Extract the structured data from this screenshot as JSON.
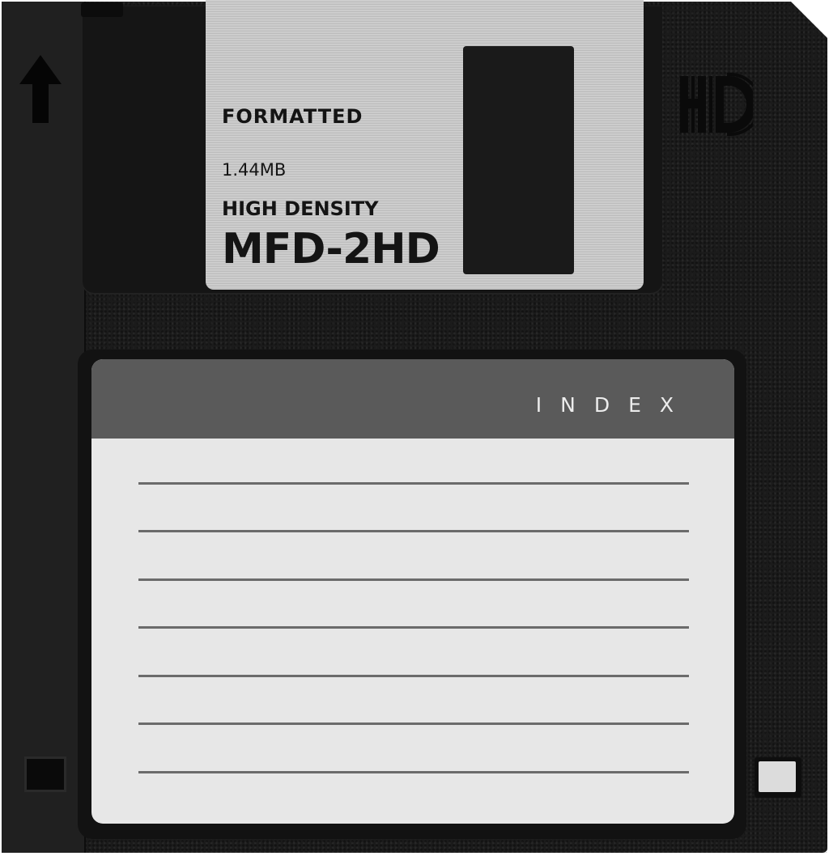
{
  "shutter_label": {
    "status": "FORMATTED",
    "capacity": "1.44MB",
    "density": "HIGH DENSITY",
    "model": "MFD-2HD"
  },
  "logo": {
    "text": "HD"
  },
  "index_label": {
    "title": "INDEX",
    "line_count": 7
  },
  "icons": {
    "insert_direction": "arrow-up-icon",
    "density_mark": "hd-logo-icon"
  },
  "colors": {
    "disk_body": "#1b1b1b",
    "shutter_metal": "#c8c8c8",
    "label_header": "#5a5a5a",
    "label_paper": "#e7e7e7"
  }
}
